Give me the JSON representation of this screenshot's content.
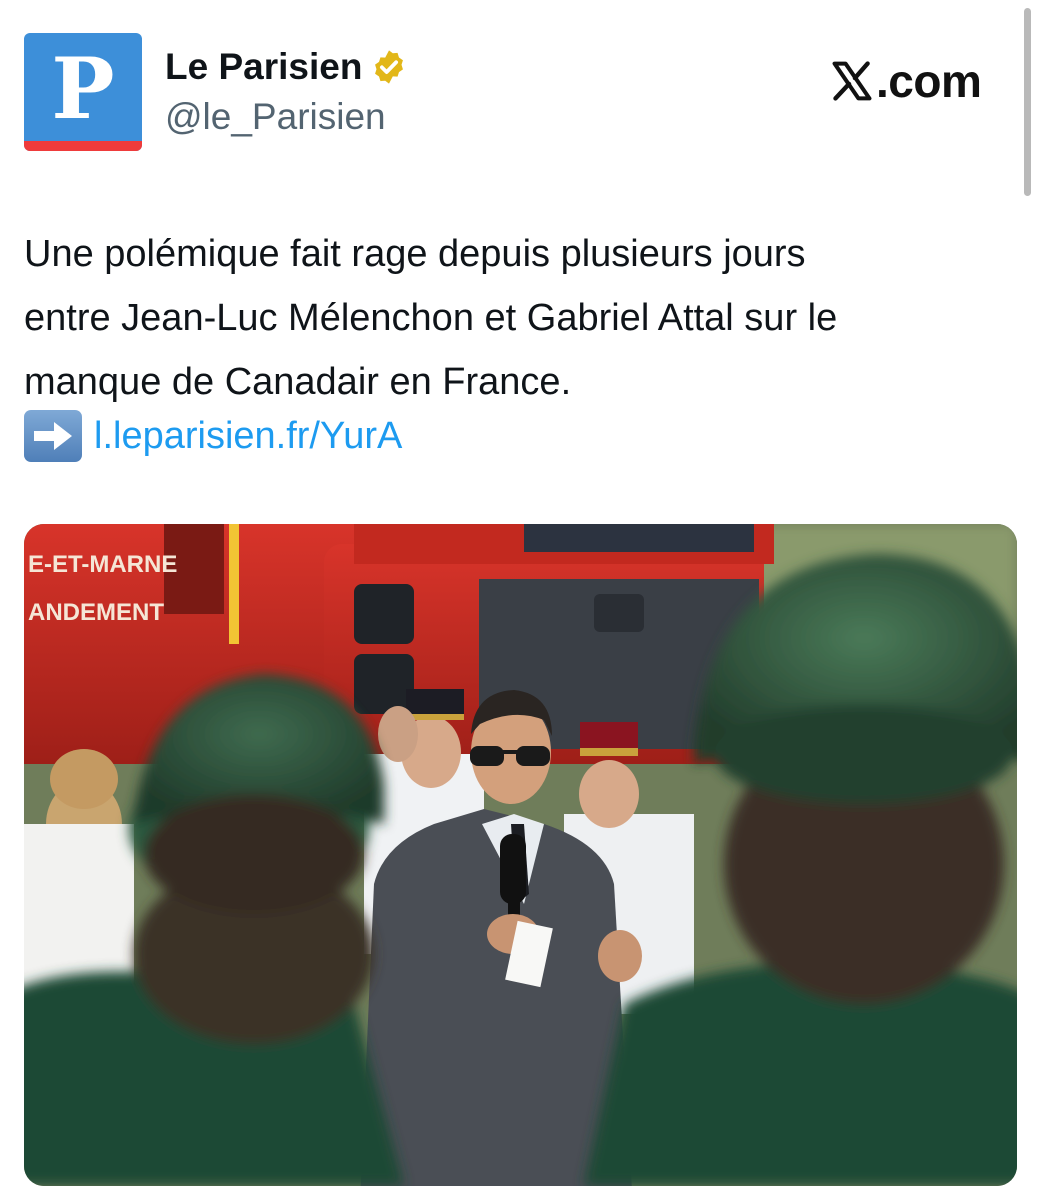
{
  "account": {
    "name": "Le Parisien",
    "handle": "@le_Parisien",
    "avatar_letter": "P",
    "verified": true,
    "verified_icon": "gold-verified-badge"
  },
  "source": {
    "label": ".com"
  },
  "tweet": {
    "text": "Une polémique fait rage depuis plusieurs jours\nentre Jean-Luc Mélenchon et Gabriel Attal sur le\nmanque de Canadair en France.",
    "link_icon": "right-arrow-emoji",
    "link_text": "l.leparisien.fr/YurA"
  },
  "photo": {
    "truck_text_line1": "E-ET-MARNE",
    "truck_text_line2": "ANDEMENT"
  },
  "colors": {
    "brand_blue": "#3d8fd9",
    "brand_red": "#ef3b3b",
    "link": "#1d9bf0",
    "handle_gray": "#536471",
    "verified_gold": "#e2b719"
  }
}
